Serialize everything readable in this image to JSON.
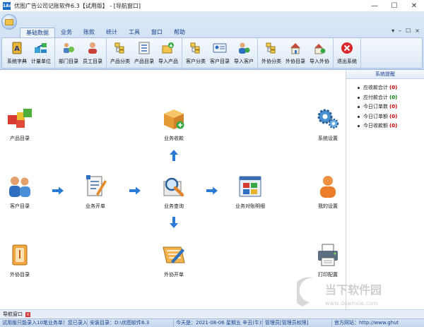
{
  "window": {
    "title": "优图广告公司记账软件6.3【试用版】 - [导航窗口]",
    "app_logo": "1Ad",
    "minimize": "—",
    "maximize": "☐",
    "close": "✕"
  },
  "ribbon": {
    "tabs": [
      "基础数据",
      "业务",
      "账款",
      "统计",
      "工具",
      "窗口",
      "帮助"
    ],
    "controls": [
      "▾",
      "–",
      "☐",
      "×"
    ],
    "groups": [
      {
        "buttons": [
          {
            "label": "系统字典",
            "icon": "dictionary-icon"
          },
          {
            "label": "计量单位",
            "icon": "units-icon"
          }
        ]
      },
      {
        "buttons": [
          {
            "label": "部门目录",
            "icon": "department-icon"
          },
          {
            "label": "员工目录",
            "icon": "employee-icon"
          }
        ]
      },
      {
        "buttons": [
          {
            "label": "产品分类",
            "icon": "product-category-icon"
          },
          {
            "label": "产品目录",
            "icon": "product-list-icon"
          },
          {
            "label": "导入产品",
            "icon": "import-product-icon"
          }
        ]
      },
      {
        "buttons": [
          {
            "label": "客户分类",
            "icon": "customer-category-icon"
          },
          {
            "label": "客户目录",
            "icon": "customer-list-icon"
          },
          {
            "label": "导入客户",
            "icon": "import-customer-icon"
          }
        ]
      },
      {
        "buttons": [
          {
            "label": "外协分类",
            "icon": "outsource-category-icon"
          },
          {
            "label": "外协目录",
            "icon": "outsource-list-icon"
          },
          {
            "label": "导入外协",
            "icon": "import-outsource-icon"
          }
        ]
      },
      {
        "buttons": [
          {
            "label": "退出系统",
            "icon": "exit-icon"
          }
        ]
      }
    ]
  },
  "nav": {
    "product_catalog": "产品目录",
    "business_receipt": "业务收款",
    "system_settings": "系统设置",
    "customer_catalog": "客户目录",
    "business_order": "业务开单",
    "business_query": "业务查询",
    "business_statement": "业务对账明细",
    "my_settings": "我的设置",
    "outsource_catalog": "外协目录",
    "outsource_order": "外协开单",
    "print_config": "打印配置"
  },
  "reminder": {
    "title": "系统提醒",
    "items": [
      {
        "label": "应收款合计",
        "count": "(0)",
        "color": "#c00000"
      },
      {
        "label": "应付款合计",
        "count": "(0)",
        "color": "#008000"
      },
      {
        "label": "今日订单数",
        "count": "(0)",
        "color": "#c00000"
      },
      {
        "label": "今日订单额",
        "count": "(0)",
        "color": "#c00000"
      },
      {
        "label": "今日收款额",
        "count": "(0)",
        "color": "#c00000"
      }
    ]
  },
  "bottom_tab": {
    "label": "导航窗口"
  },
  "status": {
    "trial": "试用版只能录入10笔业务单！您已录入了",
    "install_dir": "安装目录：D:\\优图软件6.3",
    "today": "今天是：2021-08-06 星期五 辛丑(牛)年 7",
    "user": "管理员[管理员权限]",
    "website_label": "官方网站：",
    "website": "http://www.ghut"
  },
  "watermark": {
    "text": "当下软件园",
    "url": "www.downxia.com"
  },
  "colors": {
    "ribbon_accent": "#15428b",
    "arrow": "#2b7bd6"
  }
}
